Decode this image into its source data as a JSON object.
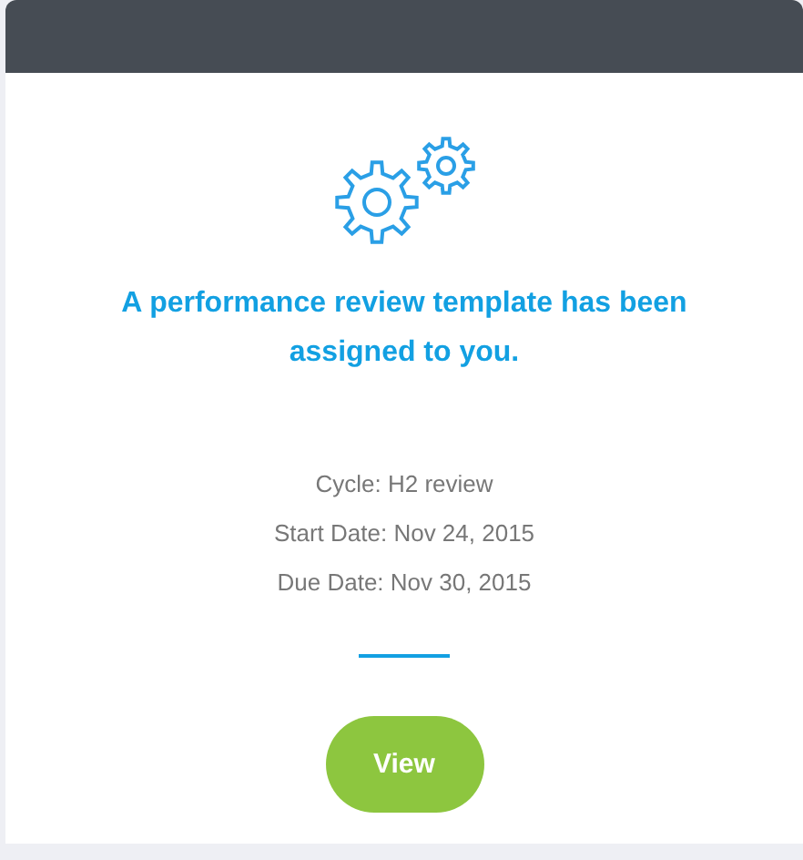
{
  "heading": "A performance review template has been assigned to you.",
  "details": [
    "Cycle: H2 review",
    "Start Date: Nov 24, 2015",
    "Due Date: Nov 30, 2015"
  ],
  "button": "View"
}
